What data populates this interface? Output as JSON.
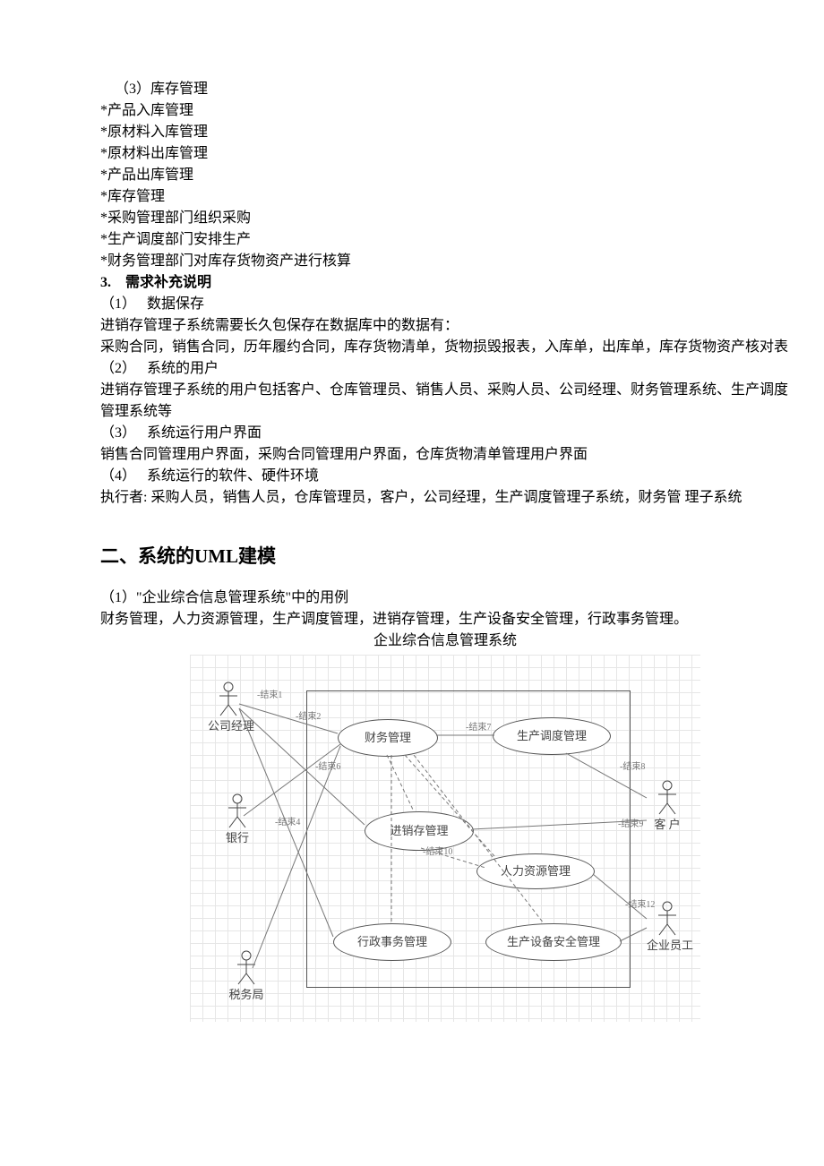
{
  "section3": {
    "title": "（3）库存管理",
    "items": [
      "*产品入库管理",
      "*原材料入库管理",
      "*原材料出库管理",
      "*产品出库管理",
      "*库存管理",
      "*采购管理部门组织采购",
      "*生产调度部门安排生产",
      "*财务管理部门对库存货物资产进行核算"
    ]
  },
  "req": {
    "heading": "3.　需求补充说明",
    "p1": {
      "title": "（1）　 数据保存",
      "body1": "进销存管理子系统需要长久包保存在数据库中的数据有：",
      "body2": "采购合同，销售合同，历年履约合同，库存货物清单，货物损毁报表，入库单，出库单，库存货物资产核对表"
    },
    "p2": {
      "title": "（2）　 系统的用户",
      "body": "进销存管理子系统的用户包括客户、仓库管理员、销售人员、采购人员、公司经理、财务管理系统、生产调度管理系统等"
    },
    "p3": {
      "title": "（3）　 系统运行用户界面",
      "body": "销售合同管理用户界面，采购合同管理用户界面，仓库货物清单管理用户界面"
    },
    "p4": {
      "title": "（4）　 系统运行的软件、硬件环境",
      "body": "执行者: 采购人员，销售人员，仓库管理员，客户，公司经理，生产调度管理子系统，财务管 理子系统"
    }
  },
  "uml": {
    "heading": "二、系统的UML建模",
    "line1": "（1）\"企业综合信息管理系统\"中的用例",
    "line2": "财务管理，人力资源管理，生产调度管理，进销存管理，生产设备安全管理，行政事务管理。",
    "caption": "企业综合信息管理系统"
  },
  "chart_data": {
    "type": "usecase-diagram",
    "system": "企业综合信息管理系统",
    "actors": [
      "公司经理",
      "银行",
      "税务局",
      "客 户",
      "企业员工"
    ],
    "usecases": [
      "财务管理",
      "生产调度管理",
      "进销存管理",
      "人力资源管理",
      "行政事务管理",
      "生产设备安全管理"
    ],
    "assoc_labels": [
      "-结束1",
      "-结束2",
      "-结束7",
      "-结束4",
      "-结束6",
      "-结束8",
      "-结束9",
      "-结束10",
      "-结束12"
    ]
  }
}
